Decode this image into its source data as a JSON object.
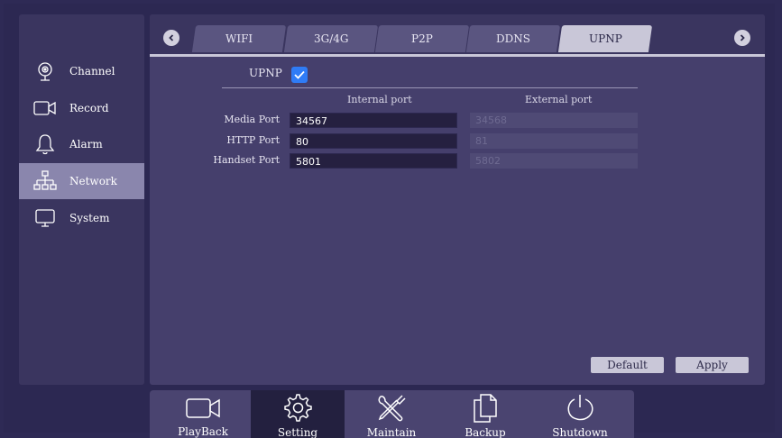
{
  "sidebar": {
    "items": [
      {
        "label": "Channel",
        "icon": "webcam-icon"
      },
      {
        "label": "Record",
        "icon": "video-camera-icon"
      },
      {
        "label": "Alarm",
        "icon": "bell-icon"
      },
      {
        "label": "Network",
        "icon": "network-icon",
        "active": true
      },
      {
        "label": "System",
        "icon": "monitor-icon"
      }
    ]
  },
  "tabs": [
    "WIFI",
    "3G/4G",
    "P2P",
    "DDNS",
    "UPNP"
  ],
  "active_tab": "UPNP",
  "upnp": {
    "label": "UPNP",
    "enabled": true,
    "internal_header": "Internal port",
    "external_header": "External port",
    "rows": [
      {
        "label": "Media Port",
        "internal": "34567",
        "external": "34568"
      },
      {
        "label": "HTTP Port",
        "internal": "80",
        "external": "81"
      },
      {
        "label": "Handset Port",
        "internal": "5801",
        "external": "5802"
      }
    ]
  },
  "buttons": {
    "default": "Default",
    "apply": "Apply"
  },
  "bottom_bar": [
    {
      "label": "PlayBack",
      "icon": "video-camera-icon"
    },
    {
      "label": "Setting",
      "icon": "gear-icon",
      "active": true
    },
    {
      "label": "Maintain",
      "icon": "tools-icon"
    },
    {
      "label": "Backup",
      "icon": "copy-icon"
    },
    {
      "label": "Shutdown",
      "icon": "power-icon"
    }
  ],
  "colors": {
    "accent": "#2f7cf6",
    "active_sidebar": "#8a86ad",
    "active_tab": "#c9c7d8"
  }
}
